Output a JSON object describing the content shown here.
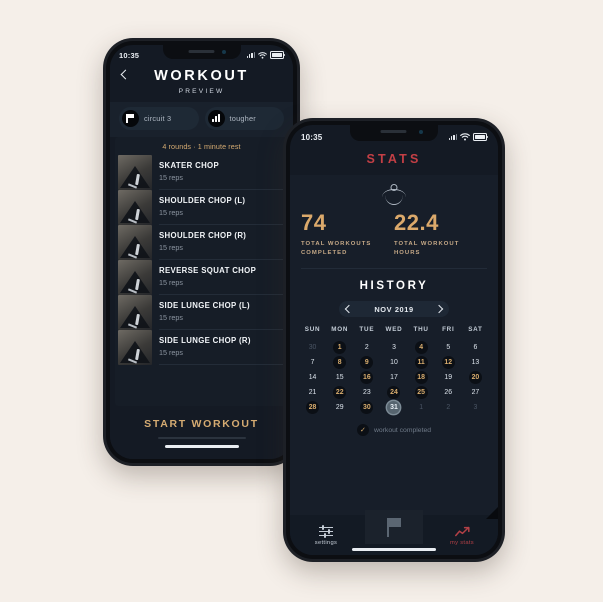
{
  "background_color": "#f5efe9",
  "accent": {
    "gold": "#d5ab72",
    "red": "#c33f45",
    "dark": "#141a24"
  },
  "workout_phone": {
    "status_bar": {
      "time": "10:35",
      "signal_icon": "signal-icon",
      "wifi_icon": "wifi-icon",
      "battery_icon": "battery-icon"
    },
    "header": {
      "back_icon": "chevron-left-icon",
      "title": "WORKOUT",
      "subtitle": "PREVIEW"
    },
    "pills": [
      {
        "icon": "flag-icon",
        "label": "circuit 3"
      },
      {
        "icon": "bar-chart-icon",
        "label": "tougher"
      }
    ],
    "rounds_text": "4 rounds · 1 minute rest",
    "exercises": [
      {
        "name": "SKATER CHOP",
        "reps": "15 reps"
      },
      {
        "name": "SHOULDER CHOP (L)",
        "reps": "15 reps"
      },
      {
        "name": "SHOULDER CHOP (R)",
        "reps": "15 reps"
      },
      {
        "name": "REVERSE SQUAT CHOP",
        "reps": "15 reps"
      },
      {
        "name": "SIDE LUNGE CHOP (L)",
        "reps": "15 reps"
      },
      {
        "name": "SIDE LUNGE CHOP (R)",
        "reps": "15 reps"
      }
    ],
    "cta_label": "START WORKOUT"
  },
  "stats_phone": {
    "status_bar": {
      "time": "10:35",
      "signal_icon": "signal-icon",
      "wifi_icon": "wifi-icon",
      "battery_icon": "battery-icon"
    },
    "title": "STATS",
    "figure_icon": "stick-figure-icon",
    "stats": [
      {
        "value": "74",
        "label": "TOTAL WORKOUTS\nCOMPLETED"
      },
      {
        "value": "22.4",
        "label": "TOTAL WORKOUT\nHOURS"
      }
    ],
    "history": {
      "heading": "HISTORY",
      "prev_icon": "chevron-left-icon",
      "month": "NOV 2019",
      "next_icon": "chevron-right-icon",
      "day_names": [
        "SUN",
        "MON",
        "TUE",
        "WED",
        "THU",
        "FRI",
        "SAT"
      ],
      "weeks": [
        [
          {
            "d": "30",
            "s": "muted"
          },
          {
            "d": "1",
            "s": "done"
          },
          {
            "d": "2",
            "s": ""
          },
          {
            "d": "3",
            "s": ""
          },
          {
            "d": "4",
            "s": "done"
          },
          {
            "d": "5",
            "s": ""
          },
          {
            "d": "6",
            "s": ""
          }
        ],
        [
          {
            "d": "7",
            "s": ""
          },
          {
            "d": "8",
            "s": "done"
          },
          {
            "d": "9",
            "s": "done"
          },
          {
            "d": "10",
            "s": ""
          },
          {
            "d": "11",
            "s": "done"
          },
          {
            "d": "12",
            "s": "done"
          },
          {
            "d": "13",
            "s": ""
          }
        ],
        [
          {
            "d": "14",
            "s": ""
          },
          {
            "d": "15",
            "s": ""
          },
          {
            "d": "16",
            "s": "done"
          },
          {
            "d": "17",
            "s": ""
          },
          {
            "d": "18",
            "s": "done"
          },
          {
            "d": "19",
            "s": ""
          },
          {
            "d": "20",
            "s": "done"
          }
        ],
        [
          {
            "d": "21",
            "s": ""
          },
          {
            "d": "22",
            "s": "done"
          },
          {
            "d": "23",
            "s": ""
          },
          {
            "d": "24",
            "s": "done"
          },
          {
            "d": "25",
            "s": "done"
          },
          {
            "d": "26",
            "s": ""
          },
          {
            "d": "27",
            "s": ""
          }
        ],
        [
          {
            "d": "28",
            "s": "done"
          },
          {
            "d": "29",
            "s": ""
          },
          {
            "d": "30",
            "s": "done"
          },
          {
            "d": "31",
            "s": "today"
          },
          {
            "d": "1",
            "s": "muted"
          },
          {
            "d": "2",
            "s": "muted"
          },
          {
            "d": "3",
            "s": "muted"
          }
        ]
      ],
      "legend": {
        "check_icon": "check-icon",
        "label": "workout completed"
      }
    },
    "tabbar": {
      "settings": {
        "icon": "sliders-icon",
        "label": "settings"
      },
      "center": {
        "icon": "flag-icon"
      },
      "mystats": {
        "icon": "trending-up-icon",
        "label": "my stats"
      }
    }
  }
}
